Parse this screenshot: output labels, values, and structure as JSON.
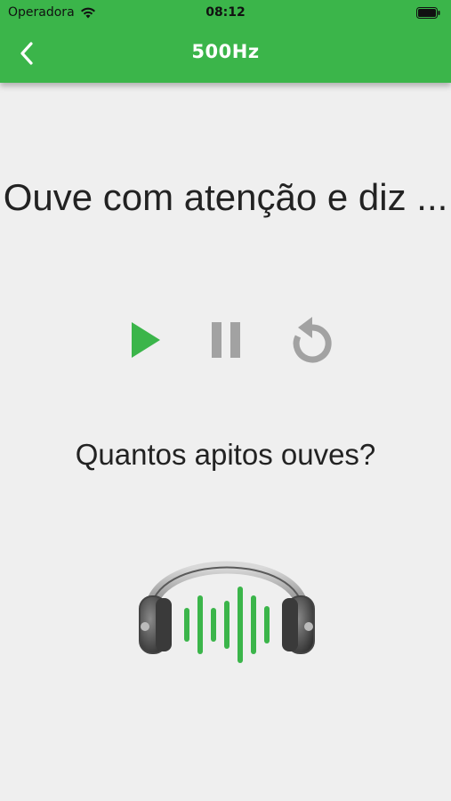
{
  "status_bar": {
    "carrier": "Operadora",
    "time": "08:12"
  },
  "nav": {
    "title": "500Hz"
  },
  "main": {
    "instruction": "Ouve com atenção e diz ...",
    "question": "Quantos apitos ouves?"
  },
  "controls": [
    {
      "name": "play",
      "icon": "play-icon"
    },
    {
      "name": "pause",
      "icon": "pause-icon"
    },
    {
      "name": "replay",
      "icon": "replay-icon"
    }
  ],
  "colors": {
    "accent": "#3bb54a",
    "play": "#3bb54a",
    "control_gray": "#a2a2a2",
    "background": "#efefef"
  }
}
